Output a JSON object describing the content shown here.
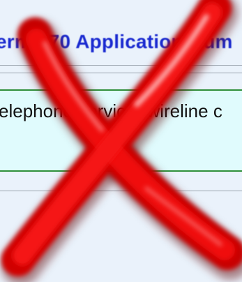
{
  "header": {
    "title": "erm 470 Application Num"
  },
  "content": {
    "text": "elephone service (wireline c"
  },
  "overlay": {
    "icon": "red-x-icon",
    "color": "#e00000"
  }
}
